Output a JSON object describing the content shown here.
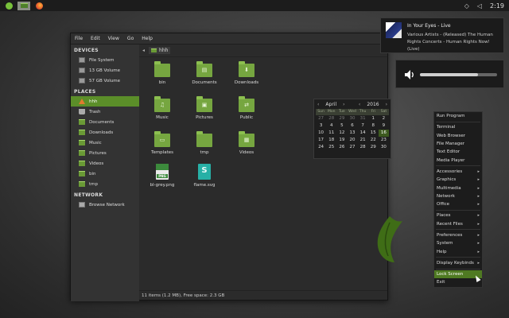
{
  "panel": {
    "launchers": [
      {
        "icon": "spotify-icon"
      },
      {
        "icon": "file-manager-icon",
        "active": true
      },
      {
        "icon": "firefox-icon"
      }
    ],
    "tray": {
      "clock": "2:19"
    }
  },
  "file_manager": {
    "menu": [
      "File",
      "Edit",
      "View",
      "Go",
      "Help"
    ],
    "sidebar": {
      "devices_heading": "DEVICES",
      "devices": [
        "File System",
        "13 GB Volume",
        "57 GB Volume"
      ],
      "places_heading": "PLACES",
      "places": [
        "hhh",
        "Trash",
        "Documents",
        "Downloads",
        "Music",
        "Pictures",
        "Videos",
        "bin",
        "tmp"
      ],
      "selected_place": "hhh",
      "network_heading": "NETWORK",
      "network": [
        "Browse Network"
      ]
    },
    "path": "hhh",
    "items": [
      {
        "label": "bin",
        "glyph": ""
      },
      {
        "label": "Documents",
        "glyph": "▤"
      },
      {
        "label": "Downloads",
        "glyph": "⬇"
      },
      {
        "label": "Music",
        "glyph": "♫"
      },
      {
        "label": "Pictures",
        "glyph": "▣"
      },
      {
        "label": "Public",
        "glyph": "⇄"
      },
      {
        "label": "Templates",
        "glyph": "▭"
      },
      {
        "label": "tmp",
        "glyph": ""
      },
      {
        "label": "Videos",
        "glyph": "▦"
      },
      {
        "label": "bl-grey.png",
        "file_tag": "PNG"
      },
      {
        "label": "flame.svg",
        "file_tag": "S"
      }
    ],
    "status": "11 items (1.2 MB), Free space: 2.3 GB"
  },
  "notification": {
    "title": "In Your Eyes - Live",
    "body": "Various Artists - (Released) The Human Rights Concerts - Human Rights Now! (Live)"
  },
  "volume": {
    "level": 0.75
  },
  "calendar": {
    "month": "April",
    "year": "2016",
    "weekdays": [
      "Sun",
      "Mon",
      "Tue",
      "Wed",
      "Thu",
      "Fri",
      "Sat"
    ],
    "days": [
      "27",
      "28",
      "29",
      "30",
      "31",
      "1",
      "2",
      "3",
      "4",
      "5",
      "6",
      "7",
      "8",
      "9",
      "10",
      "11",
      "12",
      "13",
      "14",
      "15",
      "16",
      "17",
      "18",
      "19",
      "20",
      "21",
      "22",
      "23",
      "24",
      "25",
      "26",
      "27",
      "28",
      "29",
      "30"
    ],
    "today": "16"
  },
  "desktop_menu": {
    "items": [
      {
        "label": "Run Program"
      },
      {
        "sep": true
      },
      {
        "label": "Terminal"
      },
      {
        "label": "Web Browser"
      },
      {
        "label": "File Manager"
      },
      {
        "label": "Text Editor"
      },
      {
        "label": "Media Player"
      },
      {
        "sep": true
      },
      {
        "label": "Accessories",
        "sub": true
      },
      {
        "label": "Graphics",
        "sub": true
      },
      {
        "label": "Multimedia",
        "sub": true
      },
      {
        "label": "Network",
        "sub": true
      },
      {
        "label": "Office",
        "sub": true
      },
      {
        "sep": true
      },
      {
        "label": "Places",
        "sub": true
      },
      {
        "label": "Recent Files",
        "sub": true
      },
      {
        "sep": true
      },
      {
        "label": "Preferences",
        "sub": true
      },
      {
        "label": "System",
        "sub": true
      },
      {
        "label": "Help",
        "sub": true
      },
      {
        "sep": true
      },
      {
        "label": "Display Keybinds",
        "sub": true
      },
      {
        "sep": true
      },
      {
        "label": "Lock Screen",
        "selected": true
      },
      {
        "label": "Exit"
      }
    ]
  },
  "colors": {
    "accent": "#5b8e29",
    "folder": "#76a640"
  }
}
